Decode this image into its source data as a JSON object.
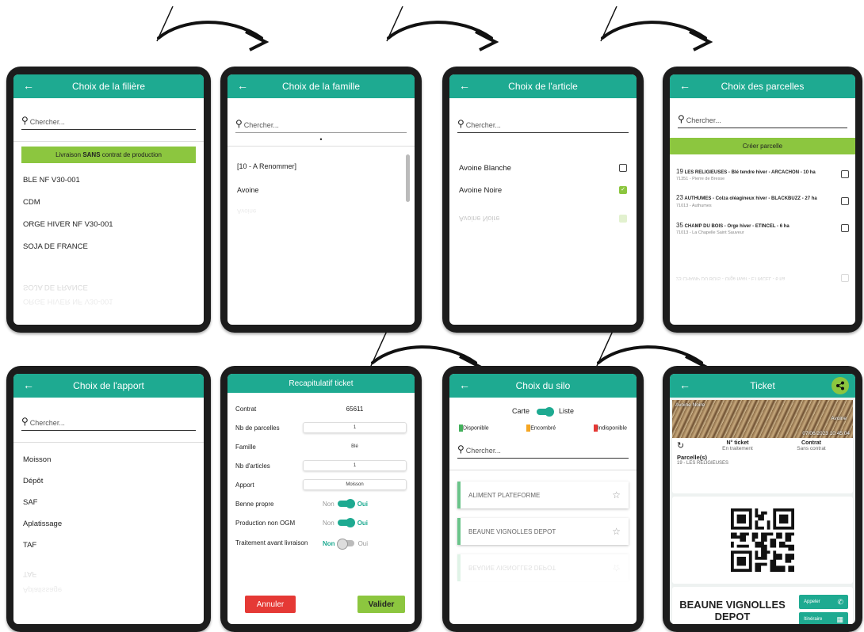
{
  "screens": {
    "filiere": {
      "title": "Choix de la filière",
      "search_placeholder": "Chercher...",
      "banner": {
        "pre": "Livraison ",
        "strong": "SANS",
        "post": " contrat de production"
      },
      "items": [
        "BLE NF V30-001",
        "CDM",
        "ORGE HIVER NF V30-001",
        "SOJA DE FRANCE"
      ],
      "faded": [
        "SOJA DE FRANCE",
        "ORGE HIVER NF V30-001"
      ]
    },
    "famille": {
      "title": "Choix de la famille",
      "search_placeholder": "Chercher...",
      "dot": "•",
      "items": [
        "[10 - A Renommer]",
        "Avoine"
      ],
      "faded": [
        "Avoine"
      ]
    },
    "article": {
      "title": "Choix de l'article",
      "search_placeholder": "Chercher...",
      "items": [
        {
          "label": "Avoine Blanche",
          "checked": false
        },
        {
          "label": "Avoine Noire",
          "checked": true
        }
      ],
      "faded": "Avoine Noire"
    },
    "parcelles": {
      "title": "Choix des parcelles",
      "search_placeholder": "Chercher...",
      "button": "Créer parcelle",
      "items": [
        {
          "num": "19",
          "title": "LES RELIGIEUSES - Blé tendre hiver - ARCACHON - 10 ha",
          "sub": "71351 - Pierre de Bresse"
        },
        {
          "num": "23",
          "title": "AUTHUMES - Colza oléagineux hiver - BLACKBUZZ - 27 ha",
          "sub": "71013 - Authumes"
        },
        {
          "num": "35",
          "title": "CHAMP DU BOIS - Orge hiver - ETINCEL - 6 ha",
          "sub": "71013 - La Chapelle Saint Sauveur"
        }
      ],
      "faded": {
        "num": "23",
        "title": "CHAMP DU BOIS - Orge hiver - ETINCEL - 6 ha"
      }
    },
    "apport": {
      "title": "Choix de l'apport",
      "search_placeholder": "Chercher...",
      "items": [
        "Moisson",
        "Dépôt",
        "SAF",
        "Aplatissage",
        "TAF"
      ],
      "faded": [
        "TAF",
        "Aplatissage"
      ]
    },
    "recap": {
      "title": "Recapitulatif ticket",
      "contrat_label": "Contrat",
      "contrat_value": "65611",
      "rows": [
        {
          "label": "Nb de parcelles",
          "value": "1"
        },
        {
          "label": "Famille",
          "value": "Blé"
        },
        {
          "label": "Nb d'articles",
          "value": "1"
        },
        {
          "label": "Apport",
          "value": "Moisson"
        }
      ],
      "toggles": [
        {
          "label": "Benne propre",
          "off": "Non",
          "on": "Oui",
          "value": "Oui"
        },
        {
          "label": "Production non OGM",
          "off": "Non",
          "on": "Oui",
          "value": "Oui"
        },
        {
          "label": "Traitement avant livraison",
          "off": "Non",
          "on": "Oui",
          "value": "Non"
        }
      ],
      "cancel": "Annuler",
      "validate": "Valider"
    },
    "silo": {
      "title": "Choix du silo",
      "mode_left": "Carte",
      "mode_right": "Liste",
      "legend": [
        {
          "label": "Disponible",
          "color": "#43b05c"
        },
        {
          "label": "Encombré",
          "color": "#f5a623"
        },
        {
          "label": "Indisponible",
          "color": "#e53935"
        }
      ],
      "search_placeholder": "Chercher...",
      "items": [
        "ALIMENT PLATEFORME",
        "BEAUNE VIGNOLLES DEPOT"
      ],
      "faded": "BEAUNE VIGNOLLES DEPOT"
    },
    "ticket": {
      "title": "Ticket",
      "photo_label": "Avoine Noire",
      "photo_sub": "Avoine",
      "photo_date": "07/06/2023 10:45:04",
      "ticket_label": "N° ticket",
      "ticket_status": "En traitement",
      "contrat_label": "Contrat",
      "contrat_value": "Sans contrat",
      "parcelles_label": "Parcelle(s)",
      "parcelles_value": "19 - LES RELIGIEUSES",
      "silo_name": "BEAUNE VIGNOLLES DEPOT",
      "call_button": "Appeler",
      "route_button": "Itinéraire"
    }
  },
  "colors": {
    "primary": "#1eaa91",
    "accent": "#8cc63f",
    "danger": "#e53935"
  }
}
